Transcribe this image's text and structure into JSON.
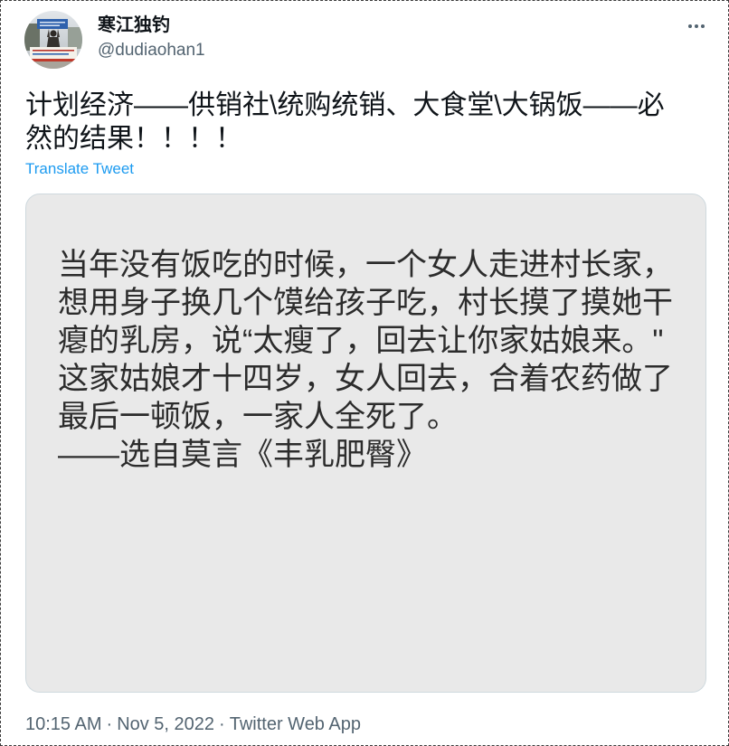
{
  "tweet": {
    "author": {
      "display_name": "寒江独钓",
      "handle": "@dudiaohan1"
    },
    "text": "计划经济——供销社\\统购统销、大食堂\\大锅饭——必然的结果！！！！",
    "translate_label": "Translate Tweet",
    "media": {
      "lines": [
        "当年没有饭吃的时候，一个女人走进村长家，",
        "想用身子换几个馍给孩子吃，村长摸了摸她干",
        "瘪的乳房，说“太瘦了，回去让你家姑娘来。\"",
        "这家姑娘才十四岁，女人回去，合着农药做了",
        "最后一顿饭，一家人全死了。",
        "——选自莫言《丰乳肥臀》"
      ]
    },
    "meta": {
      "time": "10:15 AM",
      "separator": "·",
      "date": "Nov 5, 2022",
      "source": "Twitter Web App"
    }
  },
  "icons": {
    "more": "more-horizontal-icon"
  },
  "colors": {
    "text": "#0f1419",
    "secondary": "#536471",
    "link": "#1d9bf0",
    "border": "#cfd9de",
    "media_bg": "#e9e9e9",
    "media_text": "#2c2c2c"
  }
}
